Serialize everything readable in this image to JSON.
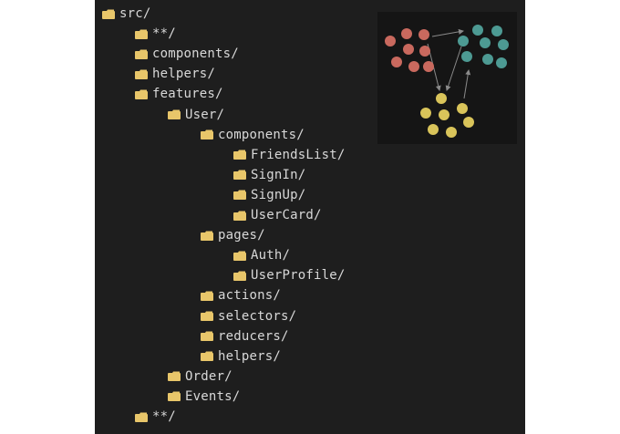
{
  "tree": [
    {
      "label": "src/",
      "depth": 0
    },
    {
      "label": "**/",
      "depth": 1
    },
    {
      "label": "components/",
      "depth": 1
    },
    {
      "label": "helpers/",
      "depth": 1
    },
    {
      "label": "features/",
      "depth": 1
    },
    {
      "label": "User/",
      "depth": 2
    },
    {
      "label": "components/",
      "depth": 3
    },
    {
      "label": "FriendsList/",
      "depth": 4
    },
    {
      "label": "SignIn/",
      "depth": 4
    },
    {
      "label": "SignUp/",
      "depth": 4
    },
    {
      "label": "UserCard/",
      "depth": 4
    },
    {
      "label": "pages/",
      "depth": 3
    },
    {
      "label": "Auth/",
      "depth": 4
    },
    {
      "label": "UserProfile/",
      "depth": 4
    },
    {
      "label": "actions/",
      "depth": 3
    },
    {
      "label": "selectors/",
      "depth": 3
    },
    {
      "label": "reducers/",
      "depth": 3
    },
    {
      "label": "helpers/",
      "depth": 3
    },
    {
      "label": "Order/",
      "depth": 2
    },
    {
      "label": "Events/",
      "depth": 2
    },
    {
      "label": "**/",
      "depth": 1
    }
  ],
  "icons": {
    "folder": "folder-icon"
  },
  "colors": {
    "background": "#1e1e1e",
    "folder": "#e8c66a",
    "text": "#d8d8d8",
    "graph_red": "#c9695e",
    "graph_teal": "#4d9a93",
    "graph_yellow": "#d9c45a",
    "graph_edge": "#8a8a8a"
  }
}
